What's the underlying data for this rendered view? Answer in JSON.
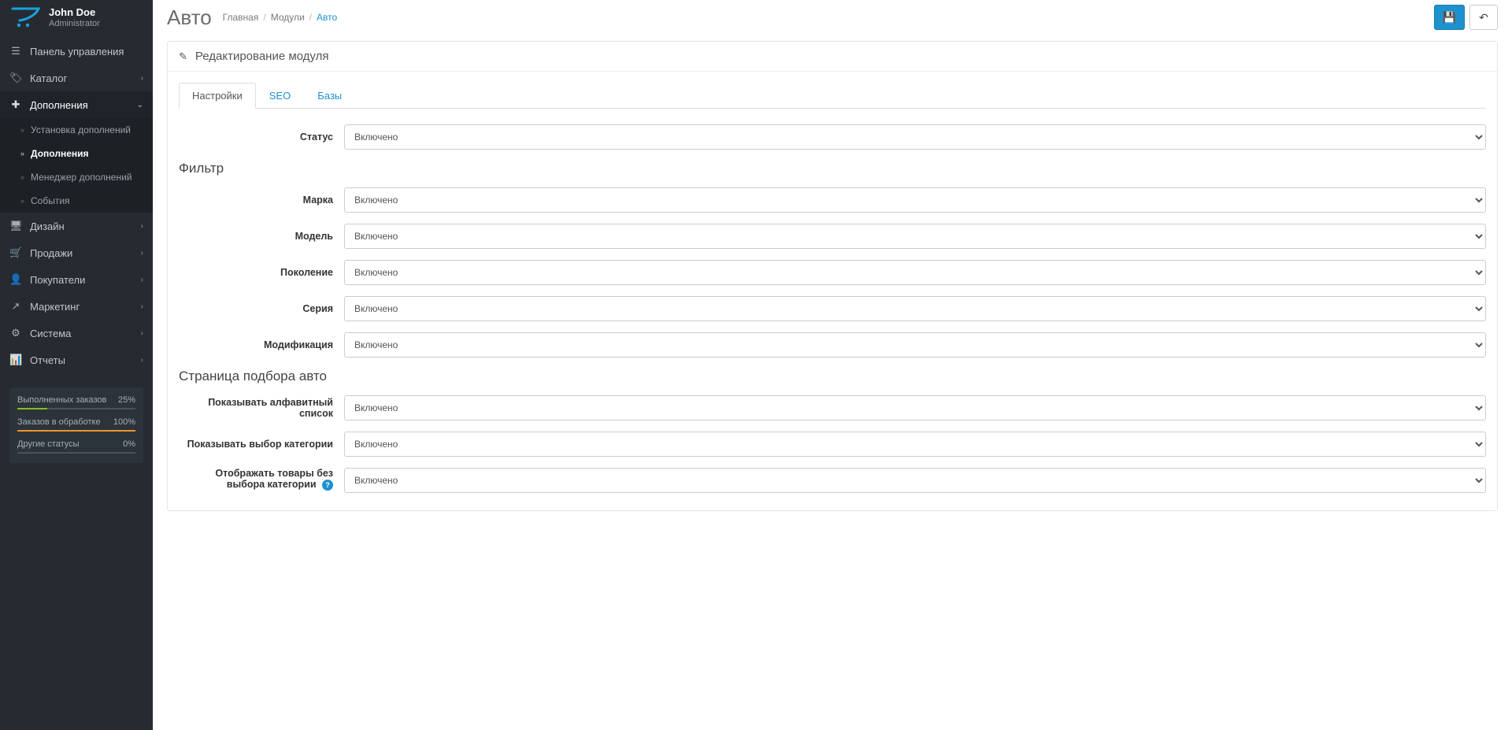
{
  "user": {
    "name": "John Doe",
    "role": "Administrator"
  },
  "nav": {
    "dashboard": "Панель управления",
    "catalog": "Каталог",
    "extensions": "Дополнения",
    "design": "Дизайн",
    "sales": "Продажи",
    "customers": "Покупатели",
    "marketing": "Маркетинг",
    "system": "Система",
    "reports": "Отчеты"
  },
  "subnav": {
    "installer": "Установка дополнений",
    "extensions": "Дополнения",
    "modifications": "Менеджер дополнений",
    "events": "События"
  },
  "stats": [
    {
      "label": "Выполненных заказов",
      "value": "25%",
      "pct": 25,
      "color": "green"
    },
    {
      "label": "Заказов в обработке",
      "value": "100%",
      "pct": 100,
      "color": "orange"
    },
    {
      "label": "Другие статусы",
      "value": "0%",
      "pct": 0,
      "color": "gray"
    }
  ],
  "page": {
    "title": "Авто",
    "breadcrumb": {
      "home": "Главная",
      "modules": "Модули",
      "current": "Авто"
    },
    "panel_title": "Редактирование модуля"
  },
  "tabs": {
    "settings": "Настройки",
    "seo": "SEO",
    "db": "Базы"
  },
  "select_option": "Включено",
  "form": {
    "status_label": "Статус",
    "filter_legend": "Фильтр",
    "brand_label": "Марка",
    "model_label": "Модель",
    "generation_label": "Поколение",
    "series_label": "Серия",
    "modification_label": "Модификация",
    "page_legend": "Страница подбора авто",
    "alpha_label": "Показывать алфавитный список",
    "category_label": "Показывать выбор категории",
    "nocat_label": "Отображать товары без выбора категории"
  }
}
